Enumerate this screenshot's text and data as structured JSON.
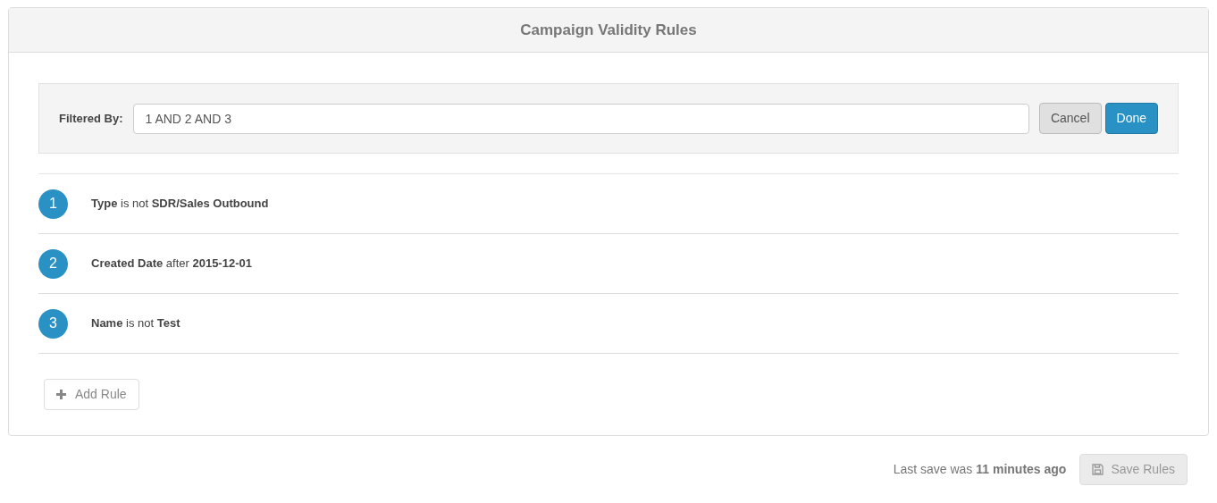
{
  "panel": {
    "title": "Campaign Validity Rules"
  },
  "filter": {
    "label": "Filtered By:",
    "value": "1 AND 2 AND 3",
    "buttons": [
      {
        "label": "Cancel",
        "kind": "secondary"
      },
      {
        "label": "Done",
        "kind": "primary"
      }
    ]
  },
  "rules": [
    {
      "number": "1",
      "text": "**Type** is not **SDR/Sales Outbound**"
    },
    {
      "number": "2",
      "text": "**Created Date** after **2015-12-01**"
    },
    {
      "number": "3",
      "text": "**Name** is not **Test**"
    }
  ],
  "add_button": {
    "label": "Add Rule"
  },
  "footer": {
    "status": "Last save was **11 minutes ago**",
    "save_button": {
      "label": "Save Rules",
      "disabled": true
    }
  }
}
